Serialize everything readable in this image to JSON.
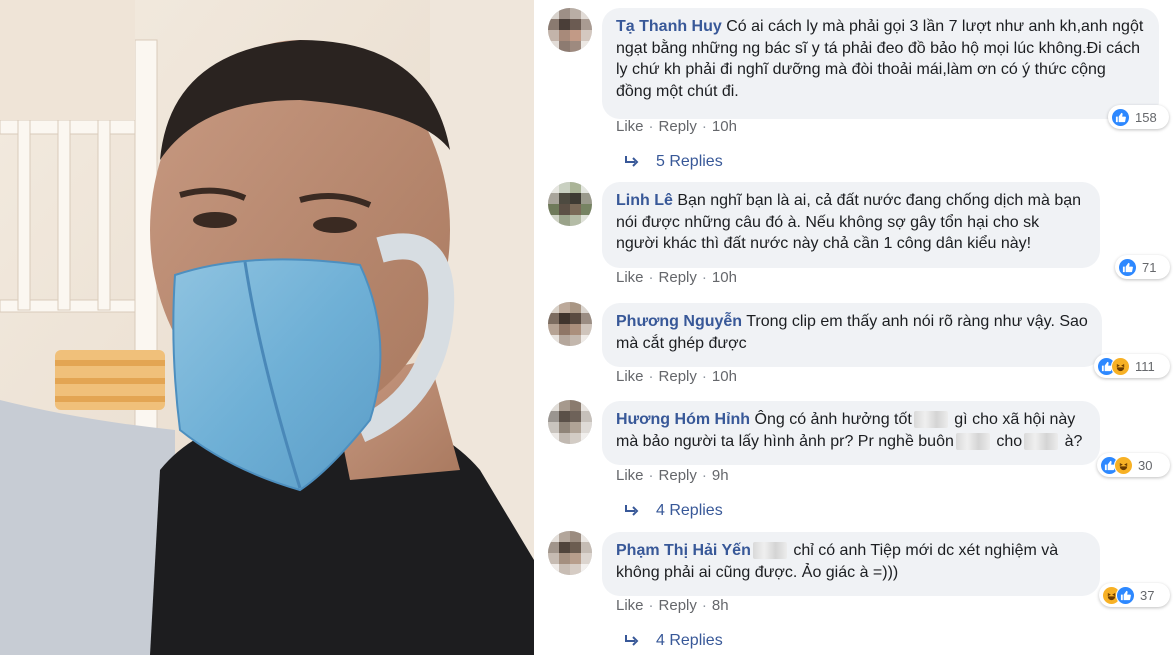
{
  "comments": [
    {
      "name": "Tạ Thanh Huy",
      "text": "Có ai cách ly mà phải gọi 3 lần 7 lượt như anh kh,anh ngột ngạt bằng những ng bác sĩ y tá phải đeo đồ bảo hộ mọi lúc không.Đi cách ly chứ kh phải đi nghĩ dưỡng mà đòi thoải mái,làm ơn có ý thức cộng đồng một chút đi.",
      "reactions": {
        "icons": [
          "like-icon"
        ],
        "count": "158"
      },
      "like_label": "Like",
      "reply_label": "Reply",
      "time": "10h",
      "replies_label": "5 Replies"
    },
    {
      "name": "Linh Lê",
      "text": "Bạn nghĩ bạn là ai, cả đất nước đang chống dịch mà bạn nói được những câu đó à.  Nếu không sợ gây tổn hại cho sk người khác thì đất nước này chả cần 1 công dân kiểu này!",
      "reactions": {
        "icons": [
          "like-icon"
        ],
        "count": "71"
      },
      "like_label": "Like",
      "reply_label": "Reply",
      "time": "10h"
    },
    {
      "name": "Phương Nguyễn",
      "text": "Trong clip em thấy anh nói rõ ràng như vậy. Sao mà cắt ghép được",
      "reactions": {
        "icons": [
          "like-icon",
          "haha-icon"
        ],
        "count": "111"
      },
      "like_label": "Like",
      "reply_label": "Reply",
      "time": "10h"
    },
    {
      "name": "Hương Hóm Hỉnh",
      "text_parts": [
        "Ông có ảnh hưởng tốt",
        "gì cho xã hội này mà bảo người ta lấy hình ảnh pr? Pr nghề buôn",
        "cho",
        "à?"
      ],
      "reactions": {
        "icons": [
          "like-icon",
          "haha-icon"
        ],
        "count": "30"
      },
      "like_label": "Like",
      "reply_label": "Reply",
      "time": "9h",
      "replies_label": "4 Replies"
    },
    {
      "name": "Phạm Thị Hải Yến",
      "text": "chỉ có anh Tiệp mới dc xét nghiệm và không phải ai cũng được. Ảo giác à =)))",
      "reactions": {
        "icons": [
          "haha-icon",
          "like-icon"
        ],
        "count": "37"
      },
      "like_label": "Like",
      "reply_label": "Reply",
      "time": "8h",
      "replies_label": "4 Replies"
    }
  ],
  "colors": {
    "name": "#385898",
    "bubble": "#f0f2f5",
    "meta": "#65676b",
    "like": "#2d88ff",
    "haha": "#f7b125"
  }
}
